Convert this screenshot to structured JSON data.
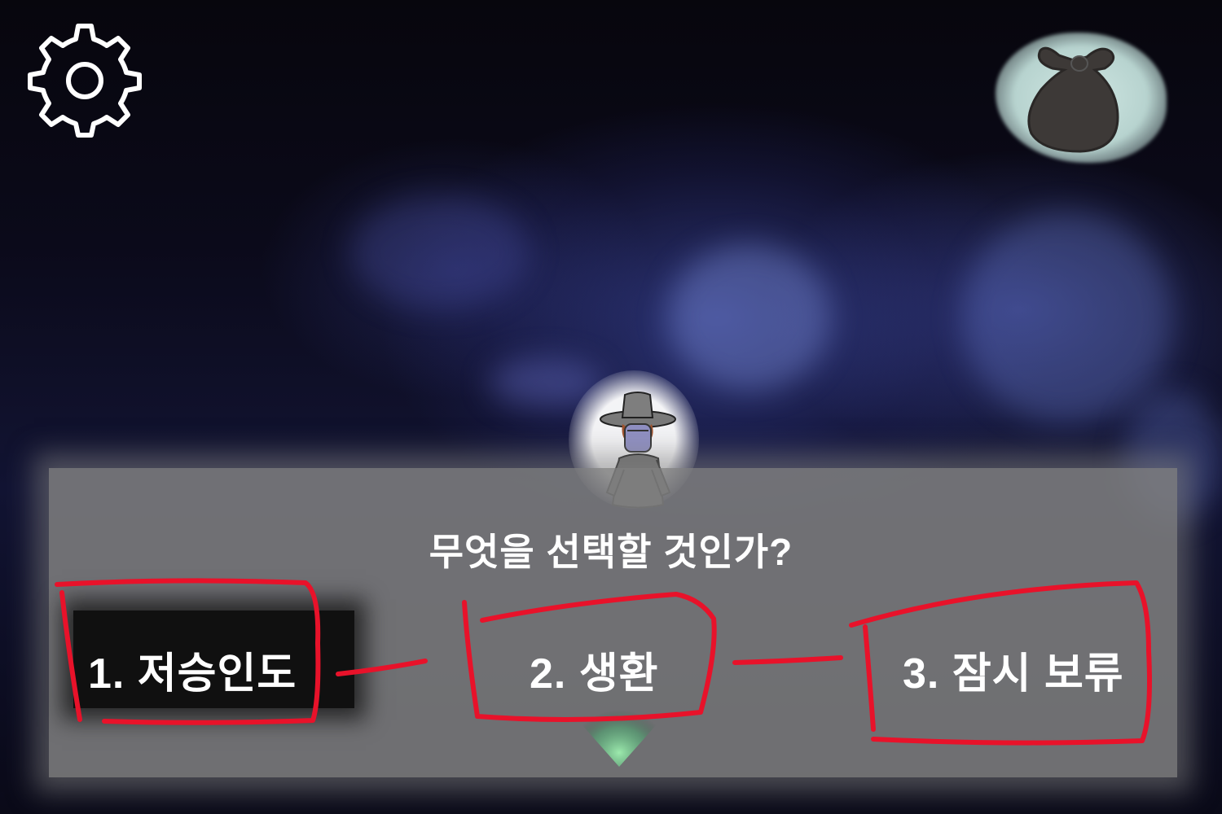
{
  "hud": {
    "settings_icon": "gear-icon",
    "inventory_icon": "bag-icon"
  },
  "scene": {
    "character": "hat-masked-figure"
  },
  "dialog": {
    "question": "무엇을 선택할 것인가?",
    "choices": [
      {
        "label": "1. 저승인도",
        "selected": true
      },
      {
        "label": "2. 생환",
        "selected": false
      },
      {
        "label": "3. 잠시 보류",
        "selected": false
      }
    ]
  },
  "colors": {
    "annotation_red": "#e8122a",
    "panel_gray": "#808080",
    "text_white": "#ffffff"
  }
}
